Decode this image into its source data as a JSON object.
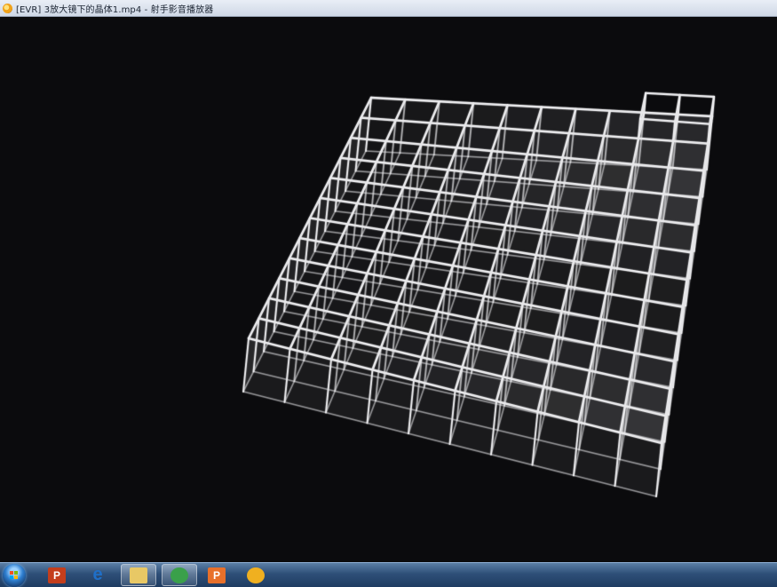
{
  "window": {
    "title": "[EVR] 3放大镜下的晶体1.mp4 - 射手影音播放器"
  },
  "video": {
    "lattice": {
      "cols": 10,
      "rows": 12,
      "line_color": "#e8e8ea",
      "face_color": "#cfcfd4"
    }
  },
  "taskbar": {
    "start_icon": "windows-start-orb",
    "items": [
      {
        "name": "powerpoint-icon",
        "letter": "P",
        "color": "#c43e1c"
      },
      {
        "name": "internet-explorer-icon",
        "letter": "e",
        "color": "#1f6fc8"
      },
      {
        "name": "file-explorer-icon",
        "letter": "",
        "color": "#e8c865"
      },
      {
        "name": "update-icon",
        "letter": "",
        "color": "#3aa04a"
      },
      {
        "name": "presenter-icon",
        "letter": "P",
        "color": "#e8702a"
      },
      {
        "name": "media-player-icon",
        "letter": "",
        "color": "#f0b020"
      }
    ]
  }
}
